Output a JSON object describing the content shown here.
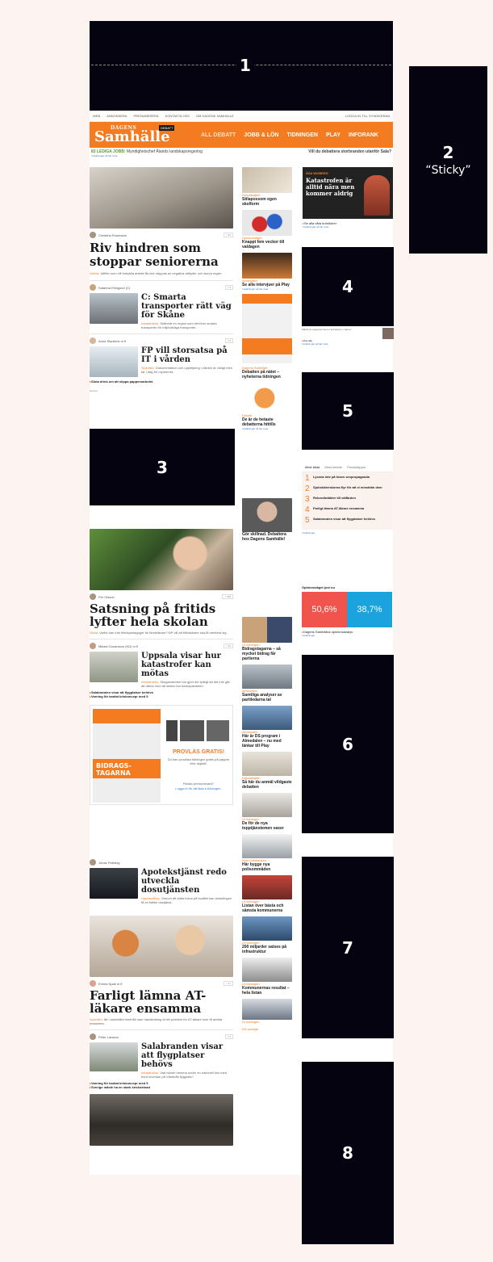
{
  "ads": {
    "ad1": "1",
    "ad2_num": "2",
    "ad2_label": "“Sticky”",
    "ad3": "3",
    "ad4": "4",
    "ad5": "5",
    "ad6": "6",
    "ad7": "7",
    "ad8": "8"
  },
  "topnav": {
    "items": [
      "WEB",
      "ANNONSERA",
      "PRENUMERERA",
      "KONTAKTA OSS",
      "OM DAGENS SAMHÄLLE"
    ],
    "login": "LOGGA IN TILL SYNDIKERAN"
  },
  "brand": {
    "small": "DAGENS",
    "name": "Samhälle",
    "tag": "DEBATT",
    "accent": "#f47b20"
  },
  "mainnav": [
    "ALL DEBATT",
    "JOBB & LÖN",
    "TIDNINGEN",
    "PLAY",
    "INFORANK"
  ],
  "subbar": {
    "left_label": "83 LEDIGA JOBB:",
    "left_text": "Myndighetschef Ålands landskapsregering",
    "left_link": "Installningar så här visar",
    "right": "Vill du debattera storbranden utanför Sala?"
  },
  "col_a": {
    "lead_byline": "Christina Rosenlam",
    "lead_share": "< 10",
    "lead_title": "Riv hindren som stoppar seniorerna",
    "lead_kicker": "Arbete.",
    "lead_body": "Alltfler som vill fortsätta arbeta får inte stoppas av negativa attityder och skeva regler.",
    "a2_byline": "Katarina Erlingson (C)",
    "a2_title": "C: Smarta transporter rätt väg för Skåne",
    "a2_kicker": "Infrastruktur.",
    "a2_body": "Skåneär en region som behöver smarta transporter för miljövänliga transporter.",
    "a3_byline": "Anna Starbrink m fl",
    "a3_title": "FP vill storsatsa på IT i vården",
    "a3_kicker": "Sjukvård.",
    "a3_body": "Dokumentation och uppföljning i vården är viktigt men tar i dag för mycket tid.",
    "a3_link": "Sluta drink om att slippa pappersarbetet",
    "ad_label": "annons",
    "a4_byline": "Per Olsson",
    "a4_share": "< 185",
    "a4_title": "Satsning på fritids lyfter hela skolan",
    "a4_kicker": "Skola.",
    "a4_body": "Varför kan inte fritidspedagoger bli förstelärare? MP vill att fritidslärare ska få meritera sig.",
    "a5_byline": "Mikael Gozarsson (KD) m fl",
    "a5_title": "Uppsala visar hur katastrofer kan mötas",
    "a5_kicker": "Infrastruktur.",
    "a5_body": "Skogsbranden har gjort det tydligt att det inte går att räkna med att staten har kriskapaciteten.",
    "a5_link1": "Salabranden visar att flygplatser behövs",
    "a5_link2": "Varning för kantat kriskoncepr med 5",
    "promo_title": "PROVLÄS GRATIS!",
    "promo_body": "Du kan provläsa tidningen gratis på papper eller digitalt.",
    "promo_q": "Redan prenumerant?",
    "promo_login": "Logga in för att läsa e-tidningen.",
    "promo_cover": "BIDRAGS-TAGARNA",
    "a6_byline": "Jonas Fritiberg",
    "a6_title": "Apotekstjänst redo utveckla dosutjänsten",
    "a6_kicker": "Upphandling.",
    "a6_body": "Genom att sätta fokus på kvalitet kan landstingen få en bättre dostjänst.",
    "a7_byline": "Emma Spak m fl",
    "a7_title": "Farligt lämna AT-läkare ensamma",
    "a7_kicker": "Sjukvård.",
    "a7_body": "Att i samhället innehåll utan handledning är ett problem för AT-läkare som få arbeta ensamma.",
    "a8_byline": "Peter Larsson",
    "a8_title": "Salabranden visar att flygplatser behövs",
    "a8_kicker": "Infrastruktur.",
    "a8_body": "Vad hände hemma under en nationell kris med bred inverkan på Västerås flygplats?",
    "a8_link1": "Varning för kantat kriskoncepr med 5",
    "a8_link2": "Sverige måste ha en stark kriskostnad"
  },
  "col_b": [
    {
      "k": "Debattsajten",
      "t": "Stilapossom egen skolform"
    },
    {
      "k": "Opinionsläget",
      "t": "Knappt fem veckor till valdagen"
    },
    {
      "k": "Almedalen",
      "t": "Se alla intervjuer på Play",
      "i": "Installningar så här visar"
    },
    {
      "k": "Dagens Samhälle",
      "t": "Debatten på nätet – nyheterna tidningen"
    },
    {
      "k": "Debatt",
      "t": "De är de hetaste debatterna hittills",
      "i": "Installningar så här visar"
    },
    {
      "k": "",
      "t": "Gör skillnad. Debattera hos Dagens Samhälle!"
    },
    {
      "k": "Ur tidningen",
      "t": "Bidragstagarna – så mycket bidrag får partierna"
    },
    {
      "k": "Almedalen",
      "t": "Samtliga analyser av partiledarna tal"
    },
    {
      "k": "Almedalen",
      "t": "Här är DS program i Almedalen – nu med länkar till Play"
    },
    {
      "k": "Debattsajten",
      "t": "Så här du anmäl vildgaste debatten"
    },
    {
      "k": "Ur tidningen",
      "t": "De för de nya topptjänstemen vaxer"
    },
    {
      "k": "Nytt i Infobanken",
      "t": "Här bygge nya polisommåden"
    },
    {
      "k": "Ur tidningen",
      "t": "Listan över bästa och sämsta kommunerna"
    },
    {
      "k": "Ur tidningen",
      "t": "200 miljarder satses på infrastruktur"
    },
    {
      "k": "Ur tidningen",
      "t": "Kommunernas resultat – hela listan"
    },
    {
      "k": "Ur tidningen",
      "t": ""
    },
    {
      "k": "DS avslöjar",
      "t": ""
    }
  ],
  "col_c": {
    "promo_name": "ÅSA WOBERG",
    "promo_title": "Katastrofen är alltid nära men kommer aldrig",
    "promo_link": "Se alla våra krönikörer",
    "promo_settings": "Installningar så här visar",
    "under4_text": "Släckt av vaga kommuns med känner i vanten",
    "under4_link": "Visa alla",
    "under4_settings": "Installningar så här visar",
    "tabs": [
      "Mest lästa",
      "Mest delade",
      "Presskläpper"
    ],
    "most_read": [
      {
        "n": "1",
        "t": "Lyssna inte på kravs sexpropaganda"
      },
      {
        "n": "2",
        "t": "Sjuksköterskorna flyr för att vi missktän dem"
      },
      {
        "n": "3",
        "t": "Rekordintäkter till välfärden"
      },
      {
        "n": "4",
        "t": "Farligt lämna AT-läkare ensamma"
      },
      {
        "n": "5",
        "t": "Salabranden visar att flygplatser behövs"
      }
    ],
    "most_read_settings": "Installningar",
    "poll_title": "Opinionsläget just nu",
    "poll_a": "50,6%",
    "poll_b": "38,7%",
    "poll_link": "Dagens Samhällos opinionsanalys",
    "poll_settings": "Installningar"
  }
}
